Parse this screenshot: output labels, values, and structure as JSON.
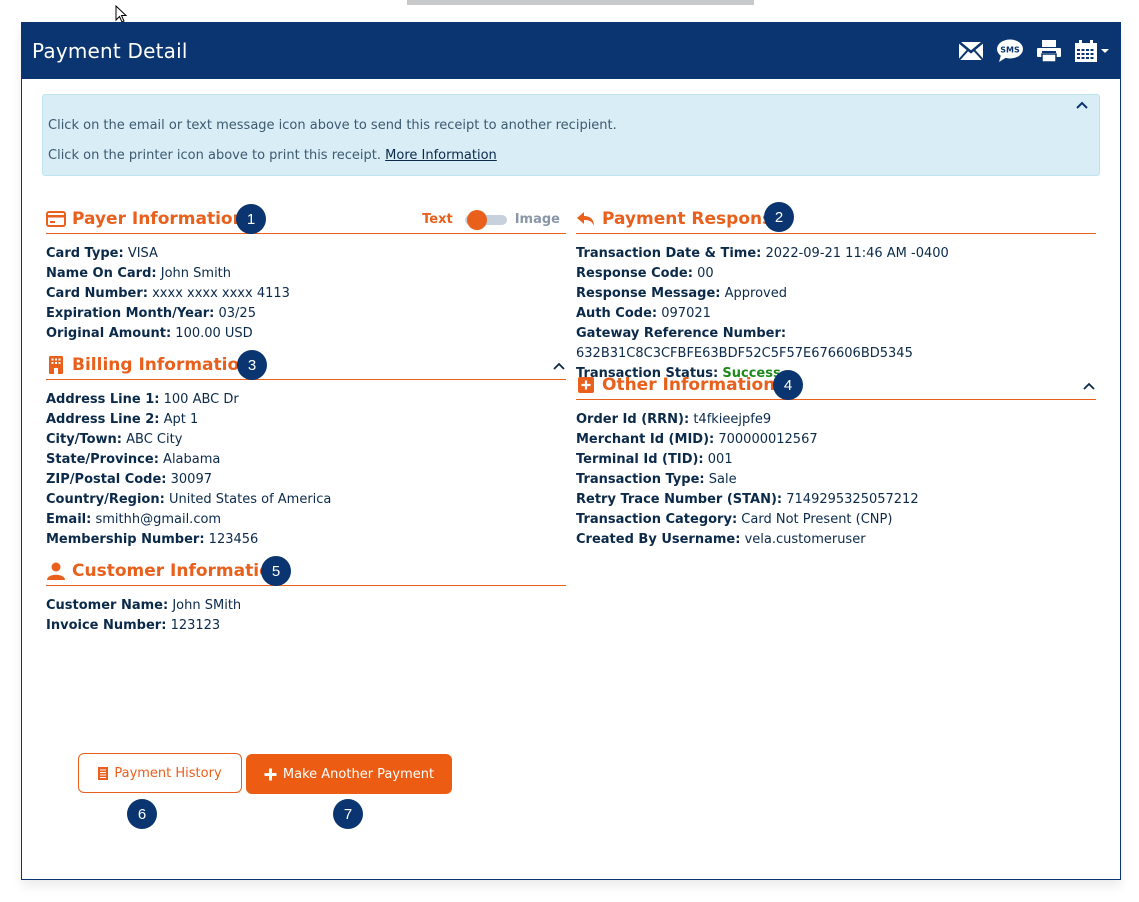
{
  "header": {
    "title": "Payment Detail",
    "icons": [
      "envelope-icon",
      "sms-icon",
      "printer-icon",
      "calendar-icon"
    ],
    "sms_label": "SMS"
  },
  "alert": {
    "line1": "Click on the email or text message icon above to send this receipt to another recipient.",
    "line2": "Click on the printer icon above to print this receipt.",
    "link": "More Information"
  },
  "colors": {
    "primary": "#0a3570",
    "accent": "#e8601c",
    "success": "#1e8a1e",
    "alert_bg": "#d9edf7"
  },
  "payer": {
    "title": "Payer Information",
    "badge": "1",
    "toggle": {
      "left": "Text",
      "right": "Image",
      "selected": "Text"
    },
    "rows": [
      {
        "k": "Card Type:",
        "v": "VISA"
      },
      {
        "k": "Name On Card:",
        "v": "John Smith"
      },
      {
        "k": "Card Number:",
        "v": "xxxx xxxx xxxx 4113"
      },
      {
        "k": "Expiration Month/Year:",
        "v": "03/25"
      },
      {
        "k": "Original Amount:",
        "v": "100.00 USD"
      }
    ]
  },
  "response": {
    "title": "Payment Response",
    "badge": "2",
    "rows": [
      {
        "k": "Transaction Date & Time:",
        "v": "2022-09-21 11:46 AM -0400"
      },
      {
        "k": "Response Code:",
        "v": "00"
      },
      {
        "k": "Response Message:",
        "v": "Approved"
      },
      {
        "k": "Auth Code:",
        "v": "097021"
      },
      {
        "k": "Gateway Reference Number:",
        "v": "632B31C8C3CFBFE63BDF52C5F57E676606BD5345"
      },
      {
        "k": "Transaction Status:",
        "v": "Success"
      }
    ]
  },
  "billing": {
    "title": "Billing Information",
    "badge": "3",
    "rows": [
      {
        "k": "Address Line 1:",
        "v": "100 ABC Dr"
      },
      {
        "k": "Address Line 2:",
        "v": "Apt 1"
      },
      {
        "k": "City/Town:",
        "v": "ABC City"
      },
      {
        "k": "State/Province:",
        "v": "Alabama"
      },
      {
        "k": "ZIP/Postal Code:",
        "v": "30097"
      },
      {
        "k": "Country/Region:",
        "v": "United States of America"
      },
      {
        "k": "Email:",
        "v": "smithh@gmail.com"
      },
      {
        "k": "Membership Number:",
        "v": "123456"
      }
    ]
  },
  "other": {
    "title": "Other Information",
    "badge": "4",
    "rows": [
      {
        "k": "Order Id (RRN):",
        "v": "t4fkieejpfe9"
      },
      {
        "k": "Merchant Id (MID):",
        "v": "700000012567"
      },
      {
        "k": "Terminal Id (TID):",
        "v": "001"
      },
      {
        "k": "Transaction Type:",
        "v": "Sale"
      },
      {
        "k": "Retry Trace Number (STAN):",
        "v": "7149295325057212"
      },
      {
        "k": "Transaction Category:",
        "v": "Card Not Present (CNP)"
      },
      {
        "k": "Created By Username:",
        "v": "vela.customeruser"
      }
    ]
  },
  "customer": {
    "title": "Customer Information",
    "badge": "5",
    "rows": [
      {
        "k": "Customer Name:",
        "v": "John SMith"
      },
      {
        "k": "Invoice Number:",
        "v": "123123"
      }
    ]
  },
  "actions": {
    "history_label": "Payment History",
    "history_badge": "6",
    "make_payment_label": "Make Another Payment",
    "make_payment_badge": "7"
  }
}
